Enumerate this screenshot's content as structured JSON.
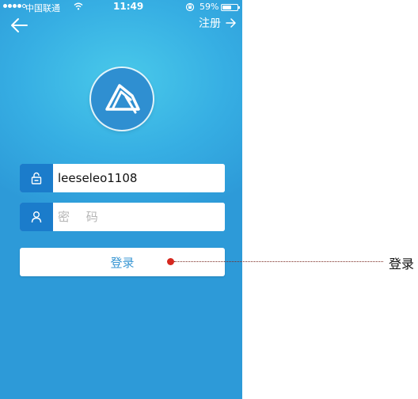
{
  "status_bar": {
    "carrier": "中国联通",
    "time": "11:49",
    "battery_percent": "59%",
    "battery_level": 0.59,
    "signal_bars_filled": 4,
    "signal_bars_total": 5
  },
  "nav": {
    "back_icon": "arrow-left-icon",
    "register_label": "注册",
    "register_icon": "arrow-right-icon"
  },
  "logo": {
    "icon": "app-logo-icon"
  },
  "form": {
    "username": {
      "icon": "unlock-icon",
      "value": "leeseleo1108"
    },
    "password": {
      "icon": "user-icon",
      "placeholder": "密 码"
    },
    "login_label": "登录"
  },
  "annotation": {
    "label": "登录",
    "dot_color": "#d6281f"
  },
  "colors": {
    "background_blue": "#2f9ad8",
    "icon_box_blue": "#1b7ccb",
    "button_text_blue": "#3a97d3"
  }
}
